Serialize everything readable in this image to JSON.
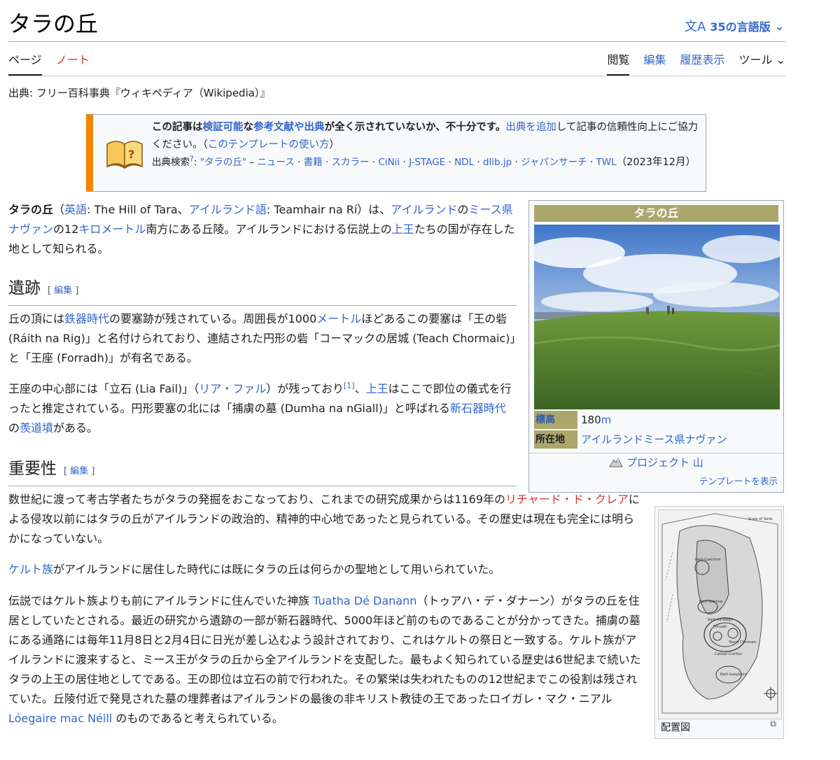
{
  "page": {
    "title": "タラの丘",
    "lang_icon": "文A",
    "lang_label": "35の言語版",
    "lang_chevron": "⌄",
    "source": "出典: フリー百科事典『ウィキペディア（Wikipedia）』"
  },
  "tabs": {
    "page": "ページ",
    "note": "ノート",
    "read": "閲覧",
    "edit": "編集",
    "history": "履歴表示",
    "tools": "ツール",
    "tools_chevron": "⌄"
  },
  "ambox": {
    "b1": "この記事は",
    "l1": "検証可能",
    "b2": "な",
    "l2": "参考文献や出典",
    "b3": "が全く示されていないか、不十分です。",
    "l3": "出典を追加",
    "t1": "して記事の信頼性向上にご協力ください。（",
    "l4": "このテンプレートの使い方",
    "t2": "）",
    "search_label": "出典検索",
    "search_q": "?",
    "search_colon": ": ",
    "s1": "\"タラの丘\"",
    "s_dash": " – ",
    "s2": "ニュース",
    "dot": " · ",
    "s3": "書籍",
    "s4": "スカラー",
    "s5": "CiNii",
    "s6": "J-STAGE",
    "s7": "NDL",
    "s8": "dlib.jp",
    "s9": "ジャパンサーチ",
    "s10": "TWL",
    "date": "（2023年12月）"
  },
  "intro": {
    "bold": "タラの丘",
    "t1": "（",
    "l1": "英語",
    "t2": ": The Hill of Tara、",
    "l2": "アイルランド語",
    "t3": ": Teamhair na Rí）は、",
    "l3": "アイルランド",
    "t4": "の",
    "l4": "ミース県",
    "l5": "ナヴァン",
    "t5": "の12",
    "l6": "キロメートル",
    "t6": "南方にある丘陵。アイルランドにおける伝説上の",
    "l7": "上王",
    "t7": "たちの国が存在した地として知られる。"
  },
  "sections": {
    "ruins": "遺跡",
    "importance": "重要性",
    "edit_open": "[ ",
    "edit": "編集",
    "edit_close": " ]"
  },
  "ruins_p1": {
    "t1": "丘の頂には",
    "l1": "鉄器時代",
    "t2": "の要塞跡が残されている。周囲長が1000",
    "l2": "メートル",
    "t3": "ほどあるこの要塞は「王の砦 (Ráith na Rig)」と名付けられており、連結された円形の砦「コーマックの居城 (Teach Chormaic)」と「王座 (Forradh)」が有名である。"
  },
  "ruins_p2": {
    "t1": "王座の中心部には「立石 (Lia Fail)」（",
    "l1": "リア・ファル",
    "t2": "）が残っており",
    "ref": "[1]",
    "t3": "、",
    "l2": "上王",
    "t4": "はここで即位の儀式を行ったと推定されている。円形要塞の北には「捕虜の墓 (Dumha na nGiall)」と呼ばれる",
    "l3": "新石器時代",
    "t5": "の",
    "l4": "羨道墳",
    "t6": "がある。"
  },
  "imp_p1": {
    "t1": "数世紀に渡って考古学者たちがタラの発掘をおこなっており、これまでの研究成果からは1169年の",
    "l1": "リチャード・ド・クレア",
    "t2": "による侵攻以前にはタラの丘がアイルランドの政治的、精神的中心地であったと見られている。その歴史は現在も完全には明らかになっていない。"
  },
  "imp_p2": {
    "l1": "ケルト族",
    "t1": "がアイルランドに居住した時代には既にタラの丘は何らかの聖地として用いられていた。"
  },
  "imp_p3": {
    "t1": "伝説ではケルト族よりも前にアイルランドに住んでいた神族 ",
    "l1": "Tuatha Dé Danann",
    "t2": "（トゥアハ・デ・ダナーン）がタラの丘を住居としていたとされる。最近の研究から遺跡の一部が新石器時代、5000年ほど前のものであることが分かってきた。捕虜の墓にある通路には毎年11月8日と2月4日に日光が差し込むよう設計されており、これはケルトの祭日と一致する。ケルト族がアイルランドに渡来すると、ミース王がタラの丘から全アイルランドを支配した。最もよく知られている歴史は6世紀まで続いたタラの上王の居住地としてである。王の即位は立石の前で行われた。その繁栄は失われたものの12世紀までこの役割は残されていた。丘陵付近で発見された墓の埋葬者はアイルランドの最後の非キリスト教徒の王であったロイガレ・マク・ニアル ",
    "l2": "Lóegaire mac Néill",
    "t3": " のものであると考えられている。"
  },
  "infobox": {
    "title": "タラの丘",
    "elev_label": "標高",
    "elev_value": "180",
    "elev_unit": "m",
    "loc_label": "所在地",
    "loc_l1": "アイルランド",
    "loc_l2": "ミース県",
    "loc_l3": "ナヴァン",
    "project_icon": "mountain-project-icon",
    "project": "プロジェクト 山",
    "template": "テンプレートを表示"
  },
  "map": {
    "caption": "配置図",
    "magnify_icon": "⧉",
    "labels": {
      "scale": "Scale of Yards",
      "l1": "Rath-Caelchon",
      "l2": "Rath-Grainne",
      "l3": "Forradh",
      "l4": "Teach Chormaic",
      "l5": "Cathair-Croifinn",
      "l6": "Rath-Laeghaire",
      "l7": "Rath-na-Riogh"
    }
  },
  "colors": {
    "link": "#3366cc",
    "redlink": "#d73333",
    "infobox_header": "#aba66b",
    "ambox_stripe": "#f28500"
  }
}
